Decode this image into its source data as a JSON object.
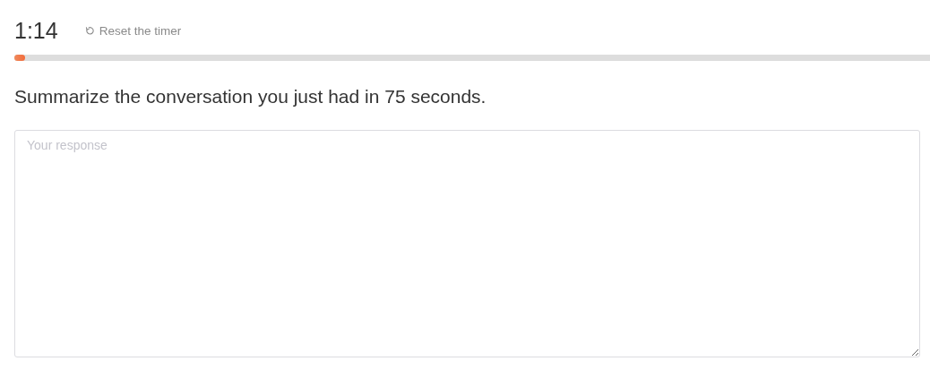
{
  "timer": {
    "time": "1:14",
    "reset_label": "Reset the timer",
    "level": 0.012
  },
  "prompt": "Summarize the conversation you just had in 75 seconds.",
  "response": {
    "placeholder": "Your response"
  }
}
